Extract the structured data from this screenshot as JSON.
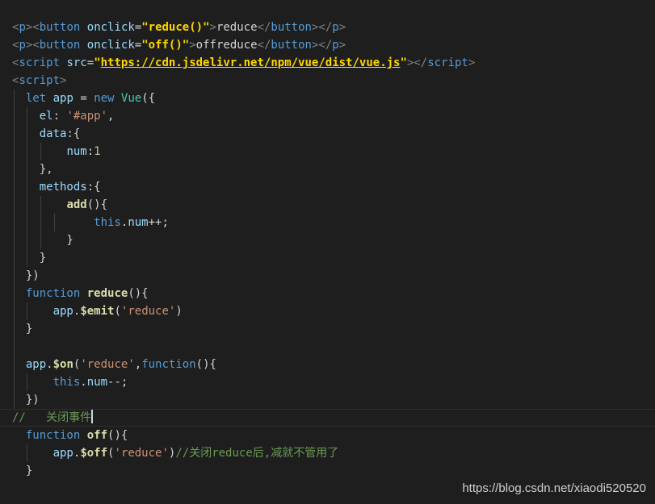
{
  "editor": {
    "lines": [
      [
        [
          "tag",
          "<"
        ],
        [
          "tn",
          "p"
        ],
        [
          "tag",
          ">"
        ],
        [
          "tag",
          "<"
        ],
        [
          "tn",
          "button"
        ],
        [
          "pl",
          " "
        ],
        [
          "at",
          "onclick"
        ],
        [
          "pl",
          "="
        ],
        [
          "st",
          "\"reduce()\""
        ],
        [
          "tag",
          ">"
        ],
        [
          "pl",
          "reduce"
        ],
        [
          "tag",
          "</"
        ],
        [
          "tn",
          "button"
        ],
        [
          "tag",
          "></"
        ],
        [
          "tn",
          "p"
        ],
        [
          "tag",
          ">"
        ]
      ],
      [
        [
          "tag",
          "<"
        ],
        [
          "tn",
          "p"
        ],
        [
          "tag",
          ">"
        ],
        [
          "tag",
          "<"
        ],
        [
          "tn",
          "button"
        ],
        [
          "pl",
          " "
        ],
        [
          "at",
          "onclick"
        ],
        [
          "pl",
          "="
        ],
        [
          "st",
          "\"off()\""
        ],
        [
          "tag",
          ">"
        ],
        [
          "pl",
          "offreduce"
        ],
        [
          "tag",
          "</"
        ],
        [
          "tn",
          "button"
        ],
        [
          "tag",
          "></"
        ],
        [
          "tn",
          "p"
        ],
        [
          "tag",
          ">"
        ]
      ],
      [
        [
          "tag",
          "<"
        ],
        [
          "tn",
          "script"
        ],
        [
          "pl",
          " "
        ],
        [
          "at",
          "src"
        ],
        [
          "pl",
          "="
        ],
        [
          "st",
          "\""
        ],
        [
          "url",
          "https://cdn.jsdelivr.net/npm/vue/dist/vue.js"
        ],
        [
          "st",
          "\""
        ],
        [
          "tag",
          "></"
        ],
        [
          "tn",
          "script"
        ],
        [
          "tag",
          ">"
        ]
      ],
      [
        [
          "tag",
          "<"
        ],
        [
          "tn",
          "script"
        ],
        [
          "tag",
          ">"
        ]
      ],
      [
        [
          "pl",
          "  "
        ],
        [
          "kw",
          "let"
        ],
        [
          "pl",
          " "
        ],
        [
          "vr",
          "app"
        ],
        [
          "pl",
          " = "
        ],
        [
          "kw",
          "new"
        ],
        [
          "pl",
          " "
        ],
        [
          "cls",
          "Vue"
        ],
        [
          "pl",
          "({"
        ]
      ],
      [
        [
          "pl",
          "    "
        ],
        [
          "vr",
          "el"
        ],
        [
          "pl",
          ": "
        ],
        [
          "sq",
          "'#app'"
        ],
        [
          "pl",
          ","
        ]
      ],
      [
        [
          "pl",
          "    "
        ],
        [
          "vr",
          "data"
        ],
        [
          "pl",
          ":{"
        ]
      ],
      [
        [
          "pl",
          "        "
        ],
        [
          "vr",
          "num"
        ],
        [
          "pl",
          ":"
        ],
        [
          "num",
          "1"
        ]
      ],
      [
        [
          "pl",
          "    },"
        ]
      ],
      [
        [
          "pl",
          "    "
        ],
        [
          "vr",
          "methods"
        ],
        [
          "pl",
          ":{"
        ]
      ],
      [
        [
          "pl",
          "        "
        ],
        [
          "fn",
          "add"
        ],
        [
          "pl",
          "(){"
        ]
      ],
      [
        [
          "pl",
          "            "
        ],
        [
          "kw",
          "this"
        ],
        [
          "pl",
          "."
        ],
        [
          "vr",
          "num"
        ],
        [
          "pl",
          "++;"
        ]
      ],
      [
        [
          "pl",
          "        }"
        ]
      ],
      [
        [
          "pl",
          "    }"
        ]
      ],
      [
        [
          "pl",
          "  })"
        ]
      ],
      [
        [
          "pl",
          "  "
        ],
        [
          "kw",
          "function"
        ],
        [
          "pl",
          " "
        ],
        [
          "fn",
          "reduce"
        ],
        [
          "pl",
          "(){"
        ]
      ],
      [
        [
          "pl",
          "      "
        ],
        [
          "vr",
          "app"
        ],
        [
          "pl",
          "."
        ],
        [
          "fn",
          "$emit"
        ],
        [
          "pl",
          "("
        ],
        [
          "sq",
          "'reduce'"
        ],
        [
          "pl",
          ")"
        ]
      ],
      [
        [
          "pl",
          "  }"
        ]
      ],
      [],
      [
        [
          "pl",
          "  "
        ],
        [
          "vr",
          "app"
        ],
        [
          "pl",
          "."
        ],
        [
          "fn",
          "$on"
        ],
        [
          "pl",
          "("
        ],
        [
          "sq",
          "'reduce'"
        ],
        [
          "pl",
          ","
        ],
        [
          "kw",
          "function"
        ],
        [
          "pl",
          "(){"
        ]
      ],
      [
        [
          "pl",
          "      "
        ],
        [
          "kw",
          "this"
        ],
        [
          "pl",
          "."
        ],
        [
          "vr",
          "num"
        ],
        [
          "pl",
          "--;"
        ]
      ],
      [
        [
          "pl",
          "  })"
        ]
      ],
      [
        [
          "cm",
          "//   关闭事件"
        ]
      ],
      [
        [
          "pl",
          "  "
        ],
        [
          "kw",
          "function"
        ],
        [
          "pl",
          " "
        ],
        [
          "fn",
          "off"
        ],
        [
          "pl",
          "(){"
        ]
      ],
      [
        [
          "pl",
          "      "
        ],
        [
          "vr",
          "app"
        ],
        [
          "pl",
          "."
        ],
        [
          "fn",
          "$off"
        ],
        [
          "pl",
          "("
        ],
        [
          "sq",
          "'reduce'"
        ],
        [
          "pl",
          ")"
        ],
        [
          "cm",
          "//关闭reduce后,减就不管用了"
        ]
      ],
      [
        [
          "pl",
          "  }"
        ]
      ]
    ]
  },
  "watermark": "https://blog.csdn.net/xiaodi520520"
}
